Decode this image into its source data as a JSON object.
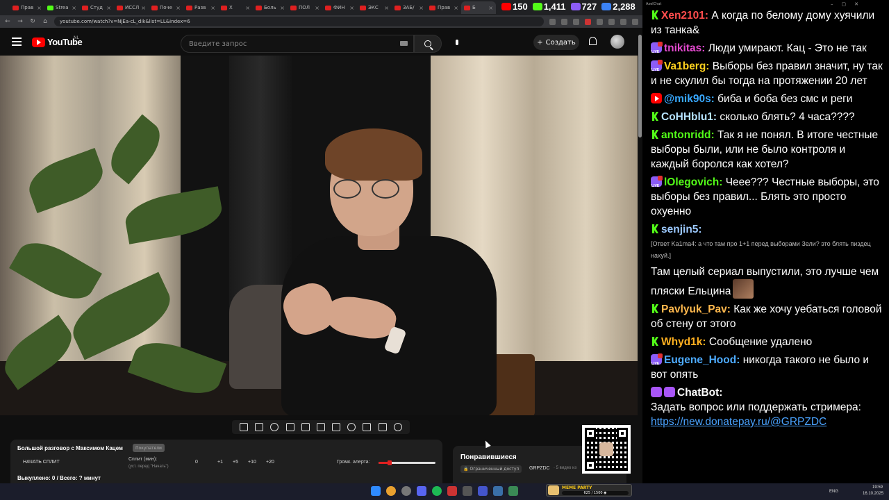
{
  "browser": {
    "tabs": [
      {
        "label": "Прав",
        "icon": "youtube-icon"
      },
      {
        "label": "Strea",
        "icon": "kick-icon"
      },
      {
        "label": "Студ",
        "icon": "youtube-icon"
      },
      {
        "label": "ИССЛ",
        "icon": "youtube-icon"
      },
      {
        "label": "Поче",
        "icon": "youtube-icon"
      },
      {
        "label": "Разв",
        "icon": "youtube-icon"
      },
      {
        "label": "Х",
        "icon": "youtube-icon"
      },
      {
        "label": "Боль",
        "icon": "youtube-icon"
      },
      {
        "label": "ПОЛ",
        "icon": "youtube-icon"
      },
      {
        "label": "ФИН",
        "icon": "youtube-icon"
      },
      {
        "label": "ЭКС",
        "icon": "youtube-icon"
      },
      {
        "label": "ЗАБ/",
        "icon": "youtube-icon"
      },
      {
        "label": "Прав",
        "icon": "youtube-icon"
      },
      {
        "label": "Б",
        "icon": "youtube-icon"
      }
    ],
    "url": "youtube.com/watch?v=NJEa-cL_dik&list=LL&index=6"
  },
  "youtube": {
    "logo_text": "YouTube",
    "country": "NL",
    "search_placeholder": "Введите запрос",
    "create_label": "Создать"
  },
  "stream_stats": [
    {
      "icon": "youtube-viewers-icon",
      "value": "150"
    },
    {
      "icon": "kick-viewers-icon",
      "value": "1,411"
    },
    {
      "icon": "vk-viewers-icon",
      "value": "727"
    },
    {
      "icon": "total-viewers-icon",
      "value": "2,288"
    }
  ],
  "split_panel": {
    "title": "Большой разговор с Максимом Кацем",
    "pill": "Покупатели",
    "start_label": "НАЧАТЬ СПЛИТ",
    "split_min_label": "Сплит (мин):",
    "split_sub": "(уст. перед \"Начать\")",
    "value_zero": "0",
    "increments": [
      "+1",
      "+5",
      "+10",
      "+20"
    ],
    "volume_label": "Громк. алерта:",
    "volume_level": 0.2,
    "footer": "Выкуплено: 0 / Всего: ? минут"
  },
  "liked_card": {
    "title": "Понравившиеся",
    "badge": "Ограниченный доступ",
    "channel": "GRPZDC",
    "count": "· 5 видео из"
  },
  "chat": {
    "window_title": "AxelChat",
    "messages": [
      {
        "platform": "kick",
        "user": "Xen2101:",
        "color": "#ff4d4d",
        "text": "А когда по белому дому хуячили из танка&"
      },
      {
        "platform": "vk",
        "user": "tnikitas:",
        "color": "#e54ad0",
        "text": "Люди умирают. Кац - Это не так"
      },
      {
        "platform": "vk",
        "user": "Va1berg:",
        "color": "#ffd21f",
        "text": "Выборы без правил значит, ну так и не скулил бы тогда на протяжении 20 лет"
      },
      {
        "platform": "youtube",
        "user": "@mik90s:",
        "color": "#38a8ff",
        "text": "биба и боба без смс и реги"
      },
      {
        "platform": "kick",
        "user": "CoHHblu1:",
        "color": "#b6e3ff",
        "text": "сколько блять? 4 часа????"
      },
      {
        "platform": "kick",
        "user": "antonridd:",
        "color": "#53fc18",
        "text": "Так я не понял. В итоге честные выборы были, или не было контроля и каждый боролся как хотел?"
      },
      {
        "platform": "vk",
        "user": "lOlegovich:",
        "color": "#53fc18",
        "text": "Чеее??? Честные выборы, это выборы без правил... Блять это просто охуенно"
      },
      {
        "platform": "kick",
        "user": "senjin5:",
        "color": "#9cc9ff",
        "reply": "[Ответ Ka1ma4: а что там про 1+1 перед выборами Зели? это блять пиздец нахуй.]",
        "text": "Там целый сериал выпустили, это лучше чем пляски Ельцина",
        "emote": "emote-face"
      },
      {
        "platform": "kick",
        "user": "Pavlyuk_Pav:",
        "color": "#ffb84d",
        "text": "Как же хочу уебаться головой об стену от этого"
      },
      {
        "platform": "kick",
        "user": "Whyd1k:",
        "color": "#ffb020",
        "text": "Сообщение удалено"
      },
      {
        "platform": "vk",
        "user": "Eugene_Hood:",
        "color": "#4dabff",
        "text": "никогда такого не было и вот опять"
      },
      {
        "platform": "bot",
        "user": "ChatBot:",
        "color": "#ffffff",
        "text": "Задать вопрос или поддержать стримера:",
        "link": "https://new.donatepay.ru/@GRPZDC"
      }
    ]
  },
  "taskbar": {
    "meme_title": "MEME PARTY",
    "meme_progress": "625 / 1500 ◉",
    "lang": "ENG",
    "time": "19:59",
    "date": "16.10.2025"
  }
}
